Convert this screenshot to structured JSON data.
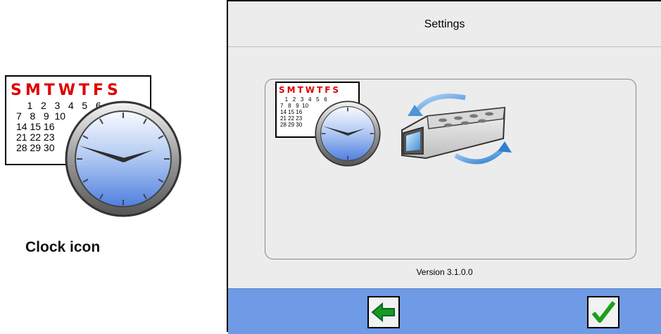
{
  "calendar": {
    "weekdays": "SMTWTFS",
    "grid": "    1   2   3   4   5   6\n7   8   9  10\n14 15 16\n21 22 23\n28 29 30",
    "grid_small": "   1   2   3   4   5   6\n7   8   9  10\n14 15 16\n21 22 23\n28 29 30"
  },
  "caption": "Clock icon",
  "window": {
    "title": "Settings",
    "version": "Version 3.1.0.0"
  },
  "icons": {
    "back": "back-arrow-icon",
    "confirm": "checkmark-icon",
    "clock": "clock-icon",
    "sync": "device-sync-icon"
  },
  "colors": {
    "bottom_bar": "#6f9ae6",
    "calendar_header": "#e00000",
    "arrow_green": "#1a9a1a"
  }
}
